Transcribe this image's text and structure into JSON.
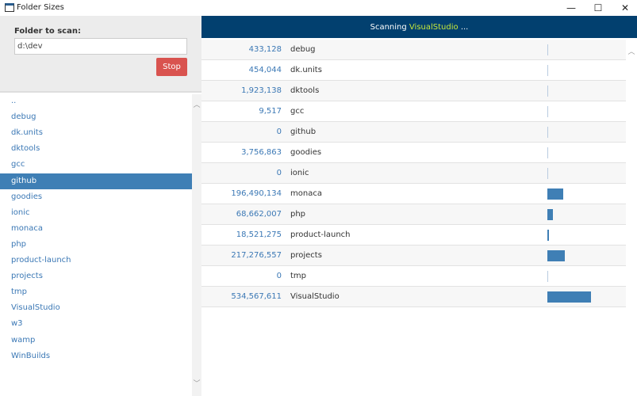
{
  "window": {
    "title": "Folder Sizes",
    "minimize": "—",
    "maximize": "☐",
    "close": "✕"
  },
  "scan": {
    "label": "Folder to scan:",
    "value": "d:\\dev",
    "stop_label": "Stop"
  },
  "sidebar": {
    "selected": "github",
    "items": [
      "..",
      "debug",
      "dk.units",
      "dktools",
      "gcc",
      "github",
      "goodies",
      "ionic",
      "monaca",
      "php",
      "product-launch",
      "projects",
      "tmp",
      "VisualStudio",
      "w3",
      "wamp",
      "WinBuilds"
    ]
  },
  "status": {
    "prefix": "Scanning ",
    "folder": "VisualStudio",
    "suffix": " ..."
  },
  "rows": [
    {
      "size": "433,128",
      "value": 433128,
      "name": "debug"
    },
    {
      "size": "454,044",
      "value": 454044,
      "name": "dk.units"
    },
    {
      "size": "1,923,138",
      "value": 1923138,
      "name": "dktools"
    },
    {
      "size": "9,517",
      "value": 9517,
      "name": "gcc"
    },
    {
      "size": "0",
      "value": 0,
      "name": "github"
    },
    {
      "size": "3,756,863",
      "value": 3756863,
      "name": "goodies"
    },
    {
      "size": "0",
      "value": 0,
      "name": "ionic"
    },
    {
      "size": "196,490,134",
      "value": 196490134,
      "name": "monaca"
    },
    {
      "size": "68,662,007",
      "value": 68662007,
      "name": "php"
    },
    {
      "size": "18,521,275",
      "value": 18521275,
      "name": "product-launch"
    },
    {
      "size": "217,276,557",
      "value": 217276557,
      "name": "projects"
    },
    {
      "size": "0",
      "value": 0,
      "name": "tmp"
    },
    {
      "size": "534,567,611",
      "value": 534567611,
      "name": "VisualStudio"
    }
  ],
  "colors": {
    "accent": "#3f7fb5",
    "header": "#02406f",
    "stop": "#d9534f",
    "highlight": "#c6e83a"
  }
}
